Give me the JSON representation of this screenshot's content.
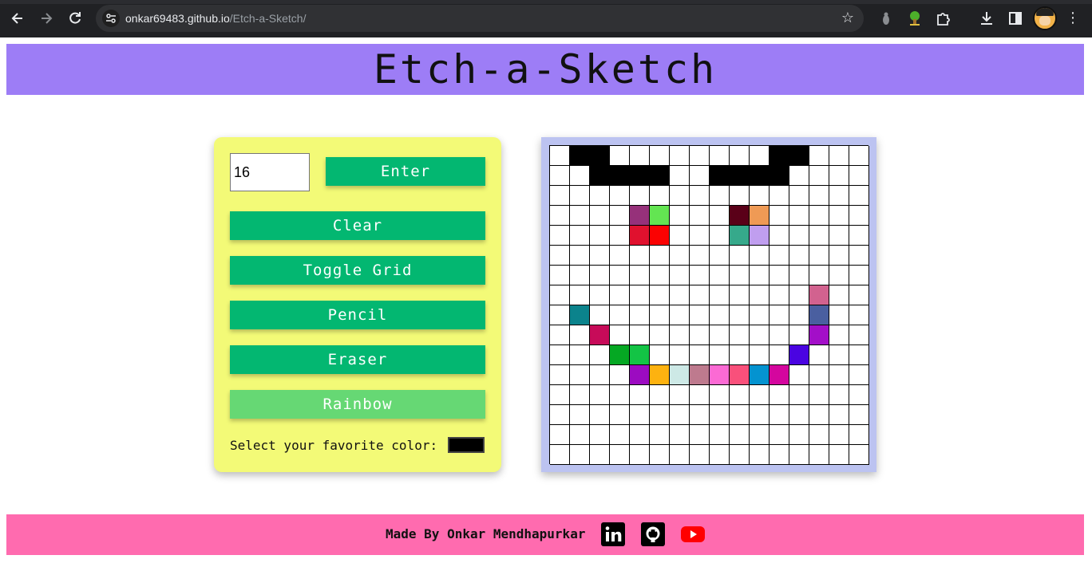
{
  "browser": {
    "url_host": "onkar69483.github.io",
    "url_path": "/Etch-a-Sketch/",
    "icons": [
      "back-arrow-icon",
      "forward-arrow-icon",
      "reload-icon",
      "site-settings-icon",
      "bookmark-star-icon",
      "extension-icon",
      "tree-extension-icon",
      "extensions-puzzle-icon",
      "download-icon",
      "side-panel-icon",
      "profile-avatar",
      "more-menu-icon"
    ]
  },
  "page": {
    "title": "Etch-a-Sketch"
  },
  "controls": {
    "grid_size_value": "16",
    "enter_label": "Enter",
    "clear_label": "Clear",
    "toggle_grid_label": "Toggle Grid",
    "pencil_label": "Pencil",
    "eraser_label": "Eraser",
    "rainbow_label": "Rainbow",
    "active_mode": "Rainbow",
    "color_label": "Select your favorite color:",
    "selected_color": "#000000"
  },
  "board": {
    "size": 16,
    "filled_cells": [
      {
        "row": 0,
        "col": 1,
        "color": "#000000"
      },
      {
        "row": 0,
        "col": 2,
        "color": "#000000"
      },
      {
        "row": 0,
        "col": 11,
        "color": "#000000"
      },
      {
        "row": 0,
        "col": 12,
        "color": "#000000"
      },
      {
        "row": 1,
        "col": 2,
        "color": "#000000"
      },
      {
        "row": 1,
        "col": 3,
        "color": "#000000"
      },
      {
        "row": 1,
        "col": 4,
        "color": "#000000"
      },
      {
        "row": 1,
        "col": 5,
        "color": "#000000"
      },
      {
        "row": 1,
        "col": 8,
        "color": "#000000"
      },
      {
        "row": 1,
        "col": 9,
        "color": "#000000"
      },
      {
        "row": 1,
        "col": 10,
        "color": "#000000"
      },
      {
        "row": 1,
        "col": 11,
        "color": "#000000"
      },
      {
        "row": 3,
        "col": 4,
        "color": "#96317a"
      },
      {
        "row": 3,
        "col": 5,
        "color": "#63e552"
      },
      {
        "row": 3,
        "col": 9,
        "color": "#5a0018"
      },
      {
        "row": 3,
        "col": 10,
        "color": "#ef9a55"
      },
      {
        "row": 4,
        "col": 4,
        "color": "#e0112e"
      },
      {
        "row": 4,
        "col": 5,
        "color": "#fb0202"
      },
      {
        "row": 4,
        "col": 9,
        "color": "#36a98b"
      },
      {
        "row": 4,
        "col": 10,
        "color": "#c09eef"
      },
      {
        "row": 7,
        "col": 13,
        "color": "#d2628f"
      },
      {
        "row": 8,
        "col": 1,
        "color": "#0b838c"
      },
      {
        "row": 8,
        "col": 13,
        "color": "#4a5fa0"
      },
      {
        "row": 9,
        "col": 2,
        "color": "#c70b59"
      },
      {
        "row": 9,
        "col": 13,
        "color": "#a30fc8"
      },
      {
        "row": 10,
        "col": 3,
        "color": "#05a823"
      },
      {
        "row": 10,
        "col": 4,
        "color": "#13c445"
      },
      {
        "row": 10,
        "col": 12,
        "color": "#4a04e1"
      },
      {
        "row": 11,
        "col": 4,
        "color": "#9c0bc1"
      },
      {
        "row": 11,
        "col": 5,
        "color": "#fdb210"
      },
      {
        "row": 11,
        "col": 6,
        "color": "#cde9e6"
      },
      {
        "row": 11,
        "col": 7,
        "color": "#be7a8e"
      },
      {
        "row": 11,
        "col": 8,
        "color": "#fb6ad4"
      },
      {
        "row": 11,
        "col": 9,
        "color": "#f9507b"
      },
      {
        "row": 11,
        "col": 10,
        "color": "#0493d0"
      },
      {
        "row": 11,
        "col": 11,
        "color": "#d4069e"
      }
    ]
  },
  "footer": {
    "text": "Made By Onkar Mendhapurkar",
    "icons": [
      "linkedin-icon",
      "github-icon",
      "youtube-icon"
    ]
  },
  "colors": {
    "header_bg": "#9d7df6",
    "controls_bg": "#f3fa77",
    "button_bg": "#03b771",
    "button_active_bg": "#66d874",
    "board_frame": "#bcc3f1",
    "footer_bg": "#ff6baf"
  }
}
